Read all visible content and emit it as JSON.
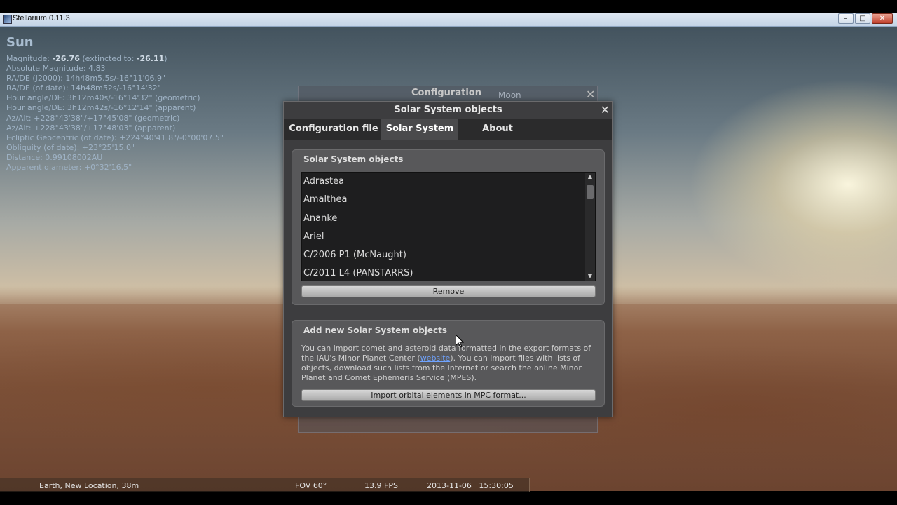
{
  "window": {
    "title": "Stellarium 0.11.3",
    "controls": [
      "–",
      "□",
      "✕"
    ]
  },
  "info": {
    "object_name": "Sun",
    "lines": [
      {
        "label": "Magnitude: ",
        "value": "-26.76",
        "rest": " (extincted to: ",
        "value2": "-26.11",
        "end": ")"
      },
      {
        "text": "Absolute Magnitude: 4.83"
      },
      {
        "text": "RA/DE (J2000): 14h48m5.5s/-16°11'06.9\""
      },
      {
        "text": "RA/DE (of date): 14h48m52s/-16°14'32\""
      },
      {
        "text": "Hour angle/DE: 3h12m40s/-16°14'32\" (geometric)"
      },
      {
        "text": "Hour angle/DE: 3h12m42s/-16°12'14\" (apparent)"
      },
      {
        "text": "Az/Alt: +228°43'38\"/+17°45'08\" (geometric)"
      },
      {
        "text": "Az/Alt: +228°43'38\"/+17°48'03\" (apparent)"
      },
      {
        "text": "Ecliptic Geocentric (of date): +224°40'41.8\"/-0°00'07.5\""
      },
      {
        "text": "Obliquity (of date): +23°25'15.0\""
      },
      {
        "text": "Distance: 0.99108002AU"
      },
      {
        "text": "Apparent diameter: +0°32'16.5\""
      }
    ]
  },
  "config_window": {
    "title": "Configuration",
    "moon_label": "Moon",
    "close": "✕"
  },
  "dialog": {
    "title": "Solar System objects",
    "close": "✕",
    "tabs": [
      "Configuration file",
      "Solar System",
      "About"
    ],
    "active_tab": "Solar System",
    "objects_panel": {
      "heading": "Solar System objects",
      "items": [
        "Adrastea",
        "Amalthea",
        "Ananke",
        "Ariel",
        "C/2006 P1 (McNaught)",
        "C/2011 L4 (PANSTARRS)"
      ],
      "remove_label": "Remove"
    },
    "add_panel": {
      "heading": "Add new Solar System objects",
      "desc_before": "You can import comet and asteroid data formatted in the export formats of the IAU's Minor Planet Center (",
      "desc_link": "website",
      "desc_after": "). You can import files with lists of objects, download such lists from the Internet or search the online Minor Planet and Comet Ephemeris Service (MPES).",
      "import_label": "Import orbital elements in MPC format..."
    }
  },
  "status": {
    "location": "Earth, New Location, 38m",
    "fov": "FOV 60°",
    "fps": "13.9 FPS",
    "datetime": "2013-11-06   15:30:05"
  }
}
